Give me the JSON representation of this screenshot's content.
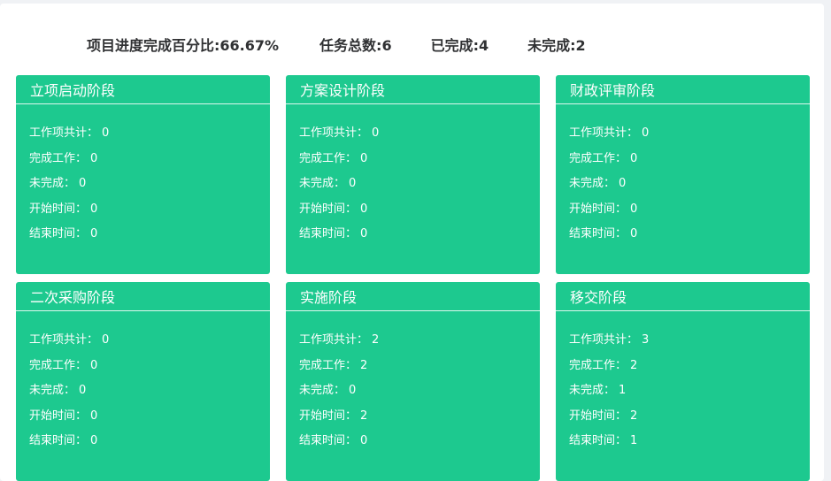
{
  "summary": {
    "progress_label": "项目进度完成百分比:66.67%",
    "total_label": "任务总数:6",
    "done_label": "已完成:4",
    "undone_label": "未完成:2"
  },
  "stages": [
    {
      "title": "立项启动阶段",
      "rows": [
        {
          "k": "工作项共计：",
          "v": "0"
        },
        {
          "k": "完成工作：",
          "v": "0"
        },
        {
          "k": "未完成：",
          "v": "0"
        },
        {
          "k": "开始时间：",
          "v": "0"
        },
        {
          "k": "结束时间：",
          "v": "0"
        }
      ]
    },
    {
      "title": "方案设计阶段",
      "rows": [
        {
          "k": "工作项共计：",
          "v": "0"
        },
        {
          "k": "完成工作：",
          "v": "0"
        },
        {
          "k": "未完成：",
          "v": "0"
        },
        {
          "k": "开始时间：",
          "v": "0"
        },
        {
          "k": "结束时间：",
          "v": "0"
        }
      ]
    },
    {
      "title": "财政评审阶段",
      "rows": [
        {
          "k": "工作项共计：",
          "v": "0"
        },
        {
          "k": "完成工作：",
          "v": "0"
        },
        {
          "k": "未完成：",
          "v": "0"
        },
        {
          "k": "开始时间：",
          "v": "0"
        },
        {
          "k": "结束时间：",
          "v": "0"
        }
      ]
    },
    {
      "title": "二次采购阶段",
      "rows": [
        {
          "k": "工作项共计：",
          "v": "0"
        },
        {
          "k": "完成工作：",
          "v": "0"
        },
        {
          "k": "未完成：",
          "v": "0"
        },
        {
          "k": "开始时间：",
          "v": "0"
        },
        {
          "k": "结束时间：",
          "v": "0"
        }
      ]
    },
    {
      "title": "实施阶段",
      "rows": [
        {
          "k": "工作项共计：",
          "v": "2"
        },
        {
          "k": "完成工作：",
          "v": "2"
        },
        {
          "k": "未完成：",
          "v": "0"
        },
        {
          "k": "开始时间：",
          "v": "2"
        },
        {
          "k": "结束时间：",
          "v": "0"
        }
      ]
    },
    {
      "title": "移交阶段",
      "rows": [
        {
          "k": "工作项共计：",
          "v": "3"
        },
        {
          "k": "完成工作：",
          "v": "2"
        },
        {
          "k": "未完成：",
          "v": "1"
        },
        {
          "k": "开始时间：",
          "v": "2"
        },
        {
          "k": "结束时间：",
          "v": "1"
        }
      ]
    }
  ],
  "colors": {
    "card_bg": "#1dc98f",
    "text_dark": "#303133"
  }
}
